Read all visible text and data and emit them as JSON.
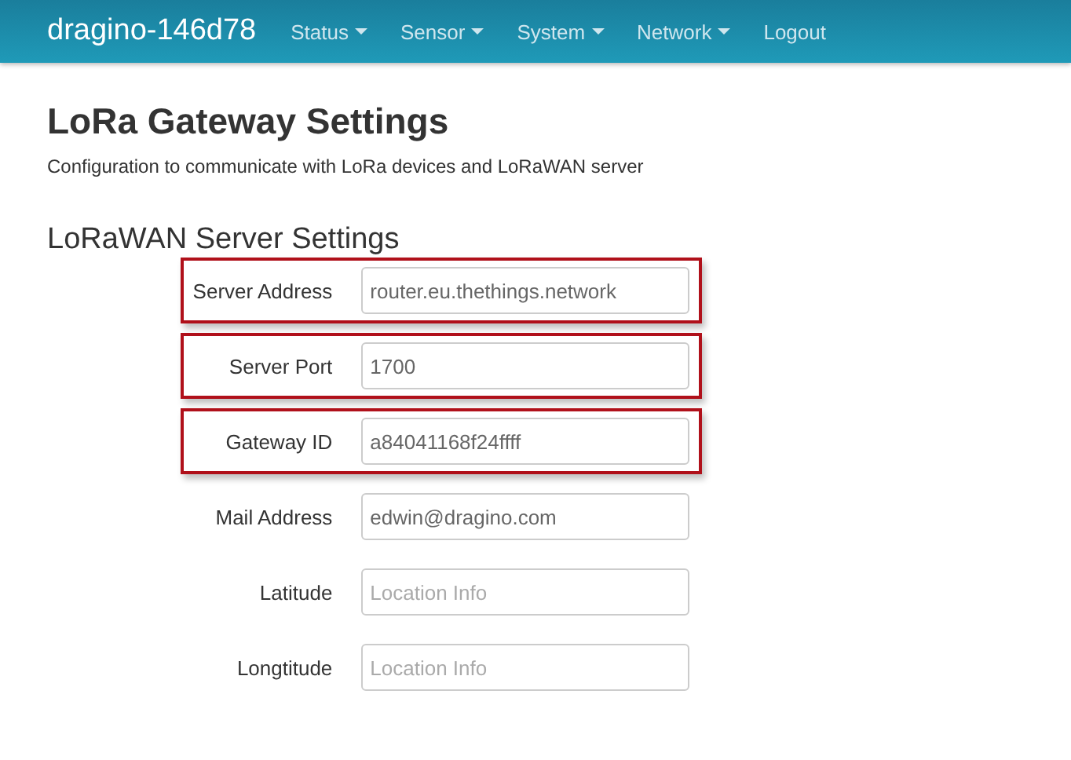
{
  "navbar": {
    "brand": "dragino-146d78",
    "menu": [
      {
        "label": "Status",
        "dropdown": true
      },
      {
        "label": "Sensor",
        "dropdown": true
      },
      {
        "label": "System",
        "dropdown": true
      },
      {
        "label": "Network",
        "dropdown": true
      },
      {
        "label": "Logout",
        "dropdown": false
      }
    ]
  },
  "page": {
    "title": "LoRa Gateway Settings",
    "description": "Configuration to communicate with LoRa devices and LoRaWAN server"
  },
  "section": {
    "title": "LoRaWAN Server Settings",
    "fields": [
      {
        "label": "Server Address",
        "value": "router.eu.thethings.network",
        "highlighted": true
      },
      {
        "label": "Server Port",
        "value": "1700",
        "highlighted": true
      },
      {
        "label": "Gateway ID",
        "value": "a84041168f24ffff",
        "highlighted": true
      },
      {
        "label": "Mail Address",
        "value": "edwin@dragino.com",
        "highlighted": false
      },
      {
        "label": "Latitude",
        "placeholder": "Location Info",
        "highlighted": false
      },
      {
        "label": "Longtitude",
        "placeholder": "Location Info",
        "highlighted": false
      }
    ]
  }
}
